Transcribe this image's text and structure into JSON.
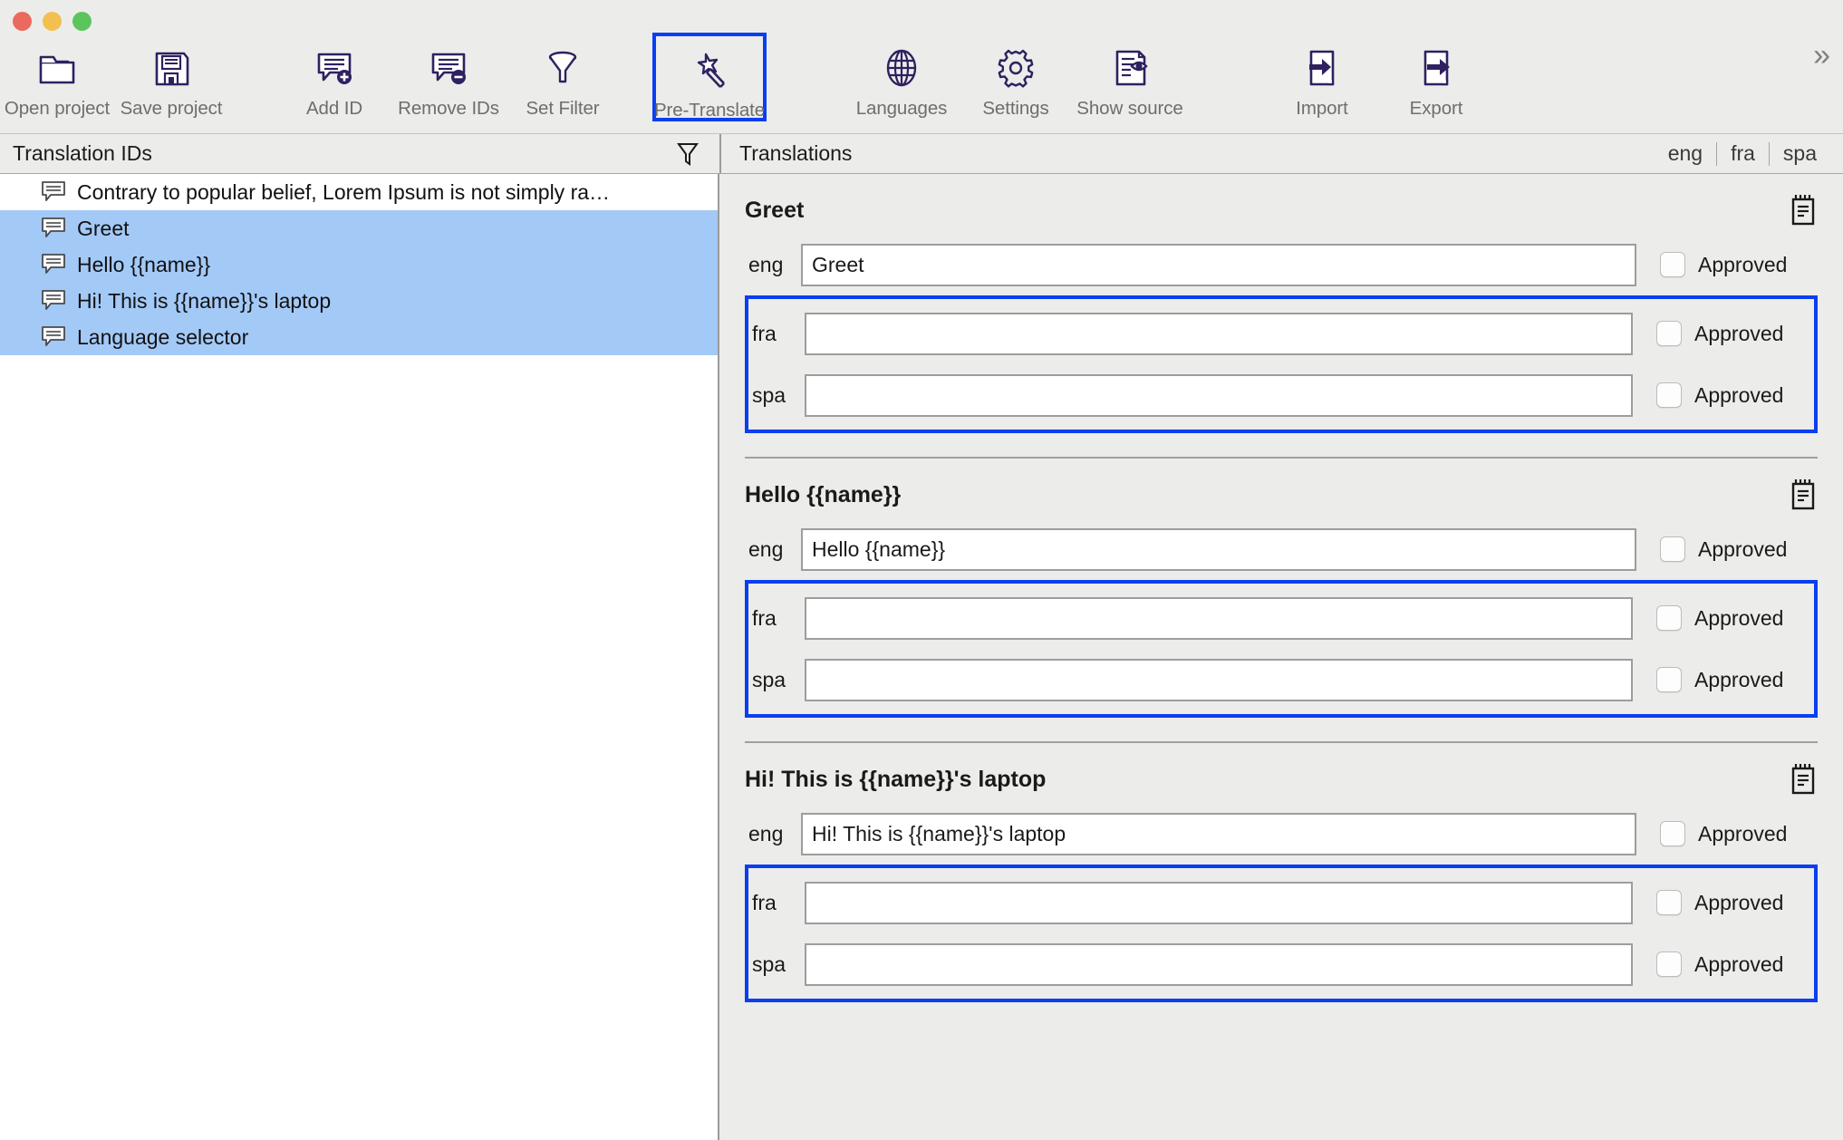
{
  "window": {
    "traffic_lights": [
      "close",
      "minimize",
      "zoom"
    ],
    "colors": {
      "close": "#ea6a5d",
      "minimize": "#f3bf4f",
      "zoom": "#5cc45d",
      "highlight": "#0a3ef0",
      "selection": "#a3c9f7",
      "icon": "#2f2060",
      "toolbar_bg": "#ececea"
    }
  },
  "toolbar": {
    "buttons": [
      {
        "label": "Open project",
        "icon": "open-folder-icon",
        "selected": false
      },
      {
        "label": "Save project",
        "icon": "floppy-disk-icon",
        "selected": false
      },
      {
        "label": "Add ID",
        "icon": "add-comment-icon",
        "selected": false
      },
      {
        "label": "Remove IDs",
        "icon": "remove-comment-icon",
        "selected": false
      },
      {
        "label": "Set Filter",
        "icon": "funnel-icon",
        "selected": false
      },
      {
        "label": "Pre-Translate",
        "icon": "magic-wand-icon",
        "selected": true
      },
      {
        "label": "Languages",
        "icon": "globe-icon",
        "selected": false
      },
      {
        "label": "Settings",
        "icon": "gear-icon",
        "selected": false
      },
      {
        "label": "Show source",
        "icon": "document-eye-icon",
        "selected": false
      },
      {
        "label": "Import",
        "icon": "import-arrow-icon",
        "selected": false
      },
      {
        "label": "Export",
        "icon": "export-arrow-icon",
        "selected": false
      }
    ],
    "overflow_label": "»"
  },
  "columns": {
    "left_title": "Translation IDs",
    "left_filter_icon": "funnel-icon",
    "right_title": "Translations",
    "language_tabs": [
      "eng",
      "fra",
      "spa"
    ]
  },
  "sidebar": {
    "items": [
      {
        "label": "Contrary to popular belief, Lorem Ipsum is not simply ra…",
        "icon": "comment-icon",
        "selected": false
      },
      {
        "label": "Greet",
        "icon": "comment-icon",
        "selected": true
      },
      {
        "label": "Hello {{name}}",
        "icon": "comment-icon",
        "selected": true
      },
      {
        "label": "Hi! This is {{name}}'s laptop",
        "icon": "comment-icon",
        "selected": true
      },
      {
        "label": "Language selector",
        "icon": "comment-icon",
        "selected": true
      }
    ]
  },
  "translations": {
    "approved_label": "Approved",
    "notes_icon": "notepad-icon",
    "blocks": [
      {
        "title": "Greet",
        "rows": [
          {
            "lang": "eng",
            "value": "Greet",
            "approved": false,
            "highlighted": false
          },
          {
            "lang": "fra",
            "value": "",
            "approved": false,
            "highlighted": true
          },
          {
            "lang": "spa",
            "value": "",
            "approved": false,
            "highlighted": true
          }
        ]
      },
      {
        "title": "Hello {{name}}",
        "rows": [
          {
            "lang": "eng",
            "value": "Hello {{name}}",
            "approved": false,
            "highlighted": false
          },
          {
            "lang": "fra",
            "value": "",
            "approved": false,
            "highlighted": true
          },
          {
            "lang": "spa",
            "value": "",
            "approved": false,
            "highlighted": true
          }
        ]
      },
      {
        "title": "Hi! This is {{name}}'s laptop",
        "rows": [
          {
            "lang": "eng",
            "value": "Hi! This is {{name}}'s laptop",
            "approved": false,
            "highlighted": false
          },
          {
            "lang": "fra",
            "value": "",
            "approved": false,
            "highlighted": true
          },
          {
            "lang": "spa",
            "value": "",
            "approved": false,
            "highlighted": true
          }
        ]
      }
    ]
  }
}
